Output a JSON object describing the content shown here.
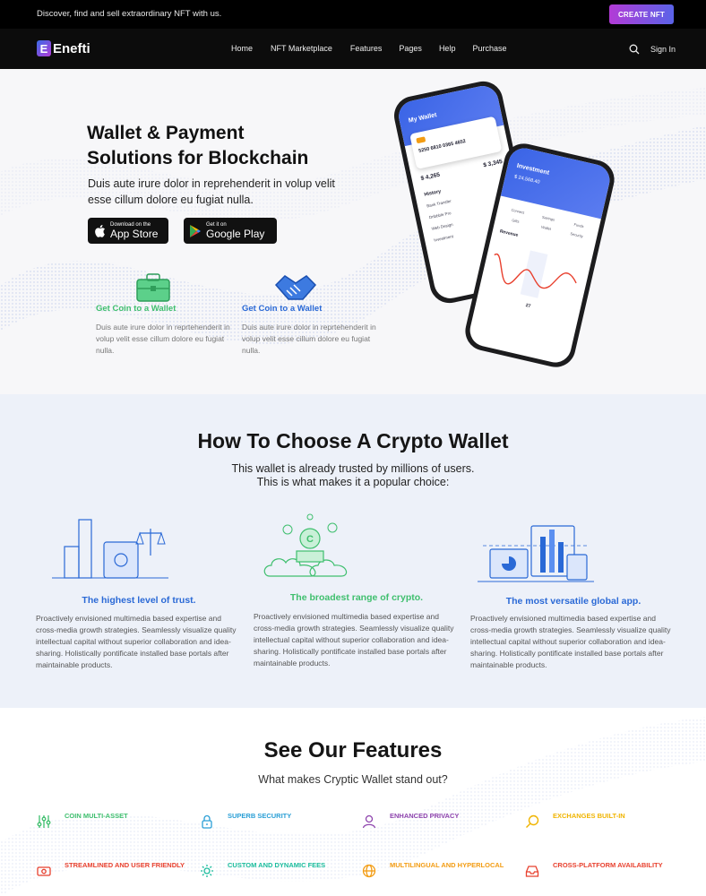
{
  "topbar": {
    "tagline": "Discover, find and sell extraordinary NFT with us.",
    "cta_label": "CREATE NFT"
  },
  "nav": {
    "logo_mark": "E",
    "logo_text": "Enefti",
    "links": [
      "Home",
      "NFT Marketplace",
      "Features",
      "Pages",
      "Help",
      "Purchase"
    ],
    "signin_label": "Sign In"
  },
  "hero": {
    "title_line1": "Wallet & Payment",
    "title_line2": "Solutions for Blockchain",
    "lead": "Duis aute irure dolor in reprehenderit in volup velit esse cillum dolore eu fugiat nulla.",
    "app_store": {
      "small": "Download on the",
      "big": "App Store"
    },
    "google_play": {
      "small": "Get it on",
      "big": "Google Play"
    },
    "mini_features": [
      {
        "title": "Get Coin to a Wallet",
        "desc": "Duis aute irure dolor in reprtehenderit in volup velit esse cillum dolore eu fugiat nulla.",
        "color": "#3fbf6e"
      },
      {
        "title": "Get Coin to a Wallet",
        "desc": "Duis aute irure dolor in reprtehenderit in volup velit esse cillum dolore eu fugiat nulla.",
        "color": "#2a69d6"
      }
    ],
    "phone_back": {
      "header": "My Wallet",
      "card_number": "5250 6810 0365 4652",
      "balance_left": "$ 4,265",
      "balance_right": "$ 3,345",
      "history_label": "History",
      "rows": [
        "Bank Transfer",
        "Dribbble Pro",
        "Web Design",
        "Investment"
      ]
    },
    "phone_front": {
      "header": "Investment",
      "amount": "$ 24,568.40",
      "revenue_label": "Revenue",
      "day_label": "27",
      "grid": [
        "Connect",
        "Savings",
        "Funds",
        "Gifts",
        "Wallet",
        "Security"
      ]
    }
  },
  "choose": {
    "title": "How To Choose A Crypto Wallet",
    "sub_line1": "This wallet is already trusted by millions of users.",
    "sub_line2": "This is what makes it a popular choice:",
    "cards": [
      {
        "title": "The highest level of trust.",
        "desc": "Proactively envisioned multimedia based expertise and cross-media growth strategies. Seamlessly visualize quality intellectual capital without superior collaboration and idea-sharing. Holistically pontificate installed base portals after maintainable products.",
        "color": "#2a69d6"
      },
      {
        "title": "The broadest range of crypto.",
        "desc": "Proactively envisioned multimedia based expertise and cross-media growth strategies. Seamlessly visualize quality intellectual capital without superior collaboration and idea-sharing. Holistically pontificate installed base portals after maintainable products.",
        "color": "#3fbf6e"
      },
      {
        "title": "The most versatile global app.",
        "desc": "Proactively envisioned multimedia based expertise and cross-media growth strategies. Seamlessly visualize quality intellectual capital without superior collaboration and idea-sharing. Holistically pontificate installed base portals after maintainable products.",
        "color": "#2a69d6"
      }
    ]
  },
  "features": {
    "title": "See Our Features",
    "sub": "What makes Cryptic Wallet stand out?",
    "items": [
      {
        "label": "COIN MULTI-ASSET",
        "color": "#3fbf6e",
        "icon": "sliders-icon"
      },
      {
        "label": "SUPERB SECURITY",
        "color": "#2a9fd6",
        "icon": "lock-icon"
      },
      {
        "label": "ENHANCED PRIVACY",
        "color": "#8e44ad",
        "icon": "user-icon"
      },
      {
        "label": "EXCHANGES BUILT-IN",
        "color": "#f0b400",
        "icon": "magnifier-icon"
      },
      {
        "label": "STREAMLINED AND USER FRIENDLY",
        "color": "#e8402e",
        "icon": "money-icon"
      },
      {
        "label": "CUSTOM AND DYNAMIC FEES",
        "color": "#1abc9c",
        "icon": "gear-icon"
      },
      {
        "label": "MULTILINGUAL AND HYPERLOCAL",
        "color": "#f39c12",
        "icon": "globe-icon"
      },
      {
        "label": "CROSS-PLATFORM AVAILABILITY",
        "color": "#e8402e",
        "icon": "inbox-icon"
      }
    ]
  }
}
